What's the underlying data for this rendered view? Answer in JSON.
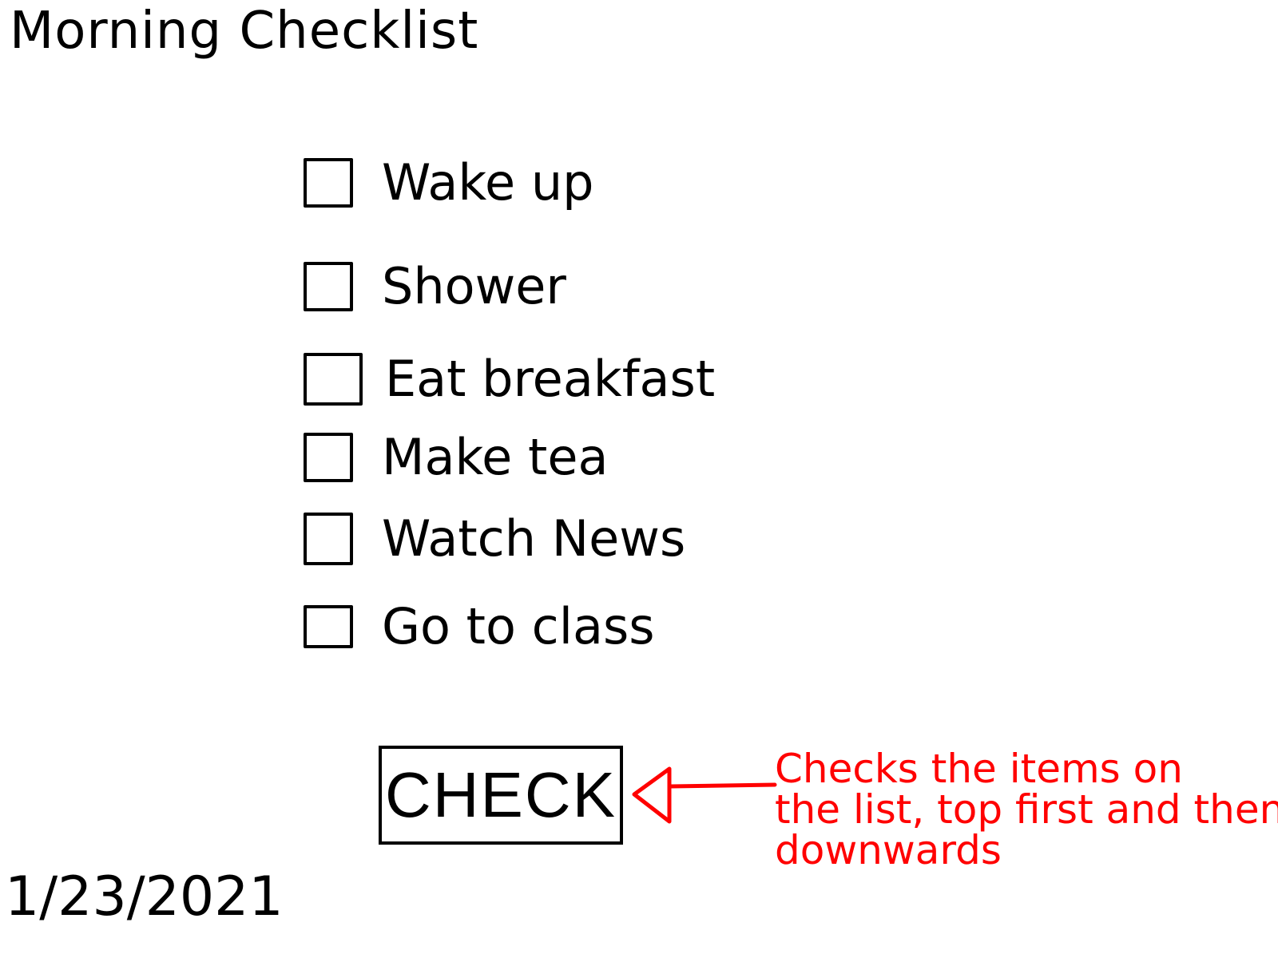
{
  "title": "Morning Checklist",
  "items": [
    {
      "label": "Wake up",
      "checked": false
    },
    {
      "label": "Shower",
      "checked": false
    },
    {
      "label": "Eat breakfast",
      "checked": false
    },
    {
      "label": "Make tea",
      "checked": false
    },
    {
      "label": "Watch News",
      "checked": false
    },
    {
      "label": "Go to class",
      "checked": false
    }
  ],
  "check_button": {
    "label": "CHECK"
  },
  "annotation": {
    "lines": [
      "Checks the items on",
      "the list, top first and then",
      "downwards"
    ],
    "color": "#ff0000"
  },
  "date": "1/23/2021"
}
